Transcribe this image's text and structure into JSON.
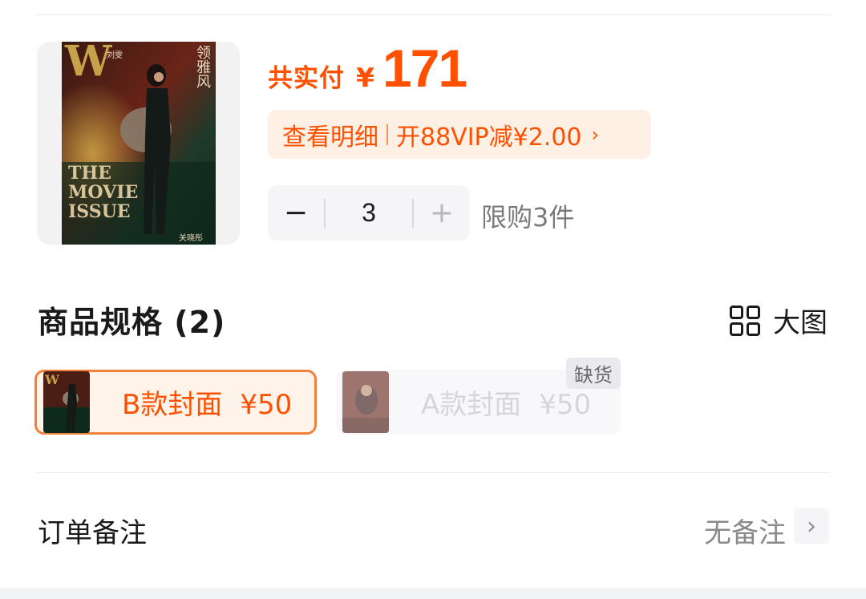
{
  "product": {
    "price_label": "共实付",
    "price_symbol": "¥",
    "price_value": "171",
    "detail_link": "查看明细",
    "vip_offer": "开88VIP减¥2.00",
    "detail_arrow": "›",
    "cover": {
      "masthead": "W",
      "top_name": "刘雯",
      "vertical_title": "领雅风",
      "headline_line1": "THE",
      "headline_line2": "MOVIE",
      "headline_line3": "ISSUE",
      "bottom_name": "关晓彤"
    }
  },
  "quantity": {
    "minus": "−",
    "value": "3",
    "plus": "+",
    "limit": "限购3件"
  },
  "spec": {
    "title": "商品规格 (2)",
    "big_view_label": "大图",
    "icons": {
      "big_view": "grid-icon"
    },
    "options": [
      {
        "name": "B款封面",
        "price": "¥50",
        "selected": true
      },
      {
        "name": "A款封面",
        "price": "¥50",
        "badge": "缺货",
        "selected": false
      }
    ]
  },
  "remark": {
    "label": "订单备注",
    "value": "无备注",
    "arrow": "›"
  },
  "colors": {
    "accent": "#ff5000",
    "pill_bg": "#fff0e6",
    "selected_border": "#f0803c",
    "muted_text": "#8a8a8a"
  }
}
